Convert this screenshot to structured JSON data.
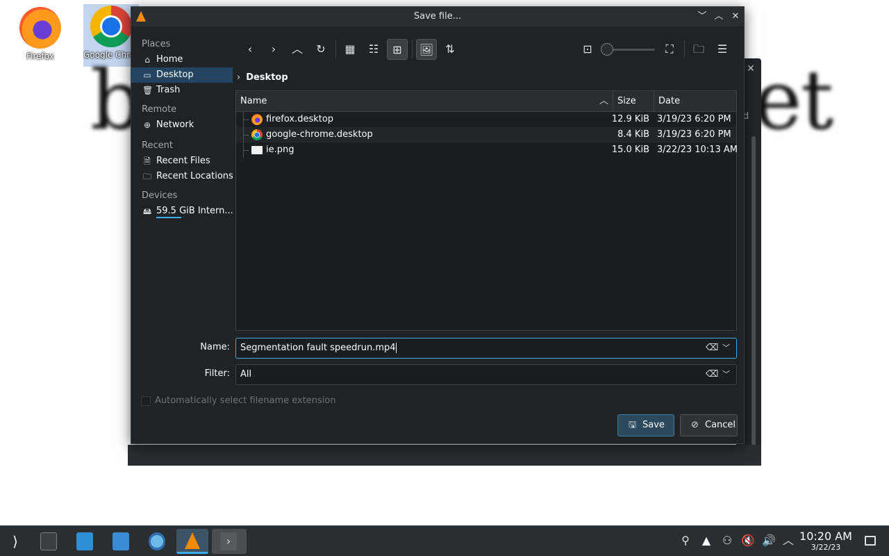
{
  "desktop": {
    "icons": [
      {
        "label": "Firefox"
      },
      {
        "label": "Google Chrome"
      }
    ],
    "bg_text_left": "b",
    "bg_text_right": "et",
    "bg_label": "d"
  },
  "dialog": {
    "title": "Save file...",
    "sidebar": {
      "places_header": "Places",
      "home": "Home",
      "desktop": "Desktop",
      "trash": "Trash",
      "remote_header": "Remote",
      "network": "Network",
      "recent_header": "Recent",
      "recent_files": "Recent Files",
      "recent_locations": "Recent Locations",
      "devices_header": "Devices",
      "device": "59.5 GiB Intern..."
    },
    "breadcrumb": "Desktop",
    "columns": {
      "name": "Name",
      "size": "Size",
      "date": "Date"
    },
    "files": [
      {
        "name": "firefox.desktop",
        "size": "12.9 KiB",
        "date": "3/19/23 6:20 PM"
      },
      {
        "name": "google-chrome.desktop",
        "size": "8.4 KiB",
        "date": "3/19/23 6:20 PM"
      },
      {
        "name": "ie.png",
        "size": "15.0 KiB",
        "date": "3/22/23 10:13 AM"
      }
    ],
    "name_label": "Name:",
    "name_value": "Segmentation fault speedrun.mp4",
    "filter_label": "Filter:",
    "filter_value": "All",
    "auto_ext_label": "Automatically select filename extension",
    "save_label": "Save",
    "cancel_label": "Cancel"
  },
  "taskbar": {
    "time": "10:20 AM",
    "date": "3/22/23"
  },
  "colors": {
    "accent": "#3daee9",
    "selection": "#234561",
    "dialog_bg": "#202326"
  }
}
